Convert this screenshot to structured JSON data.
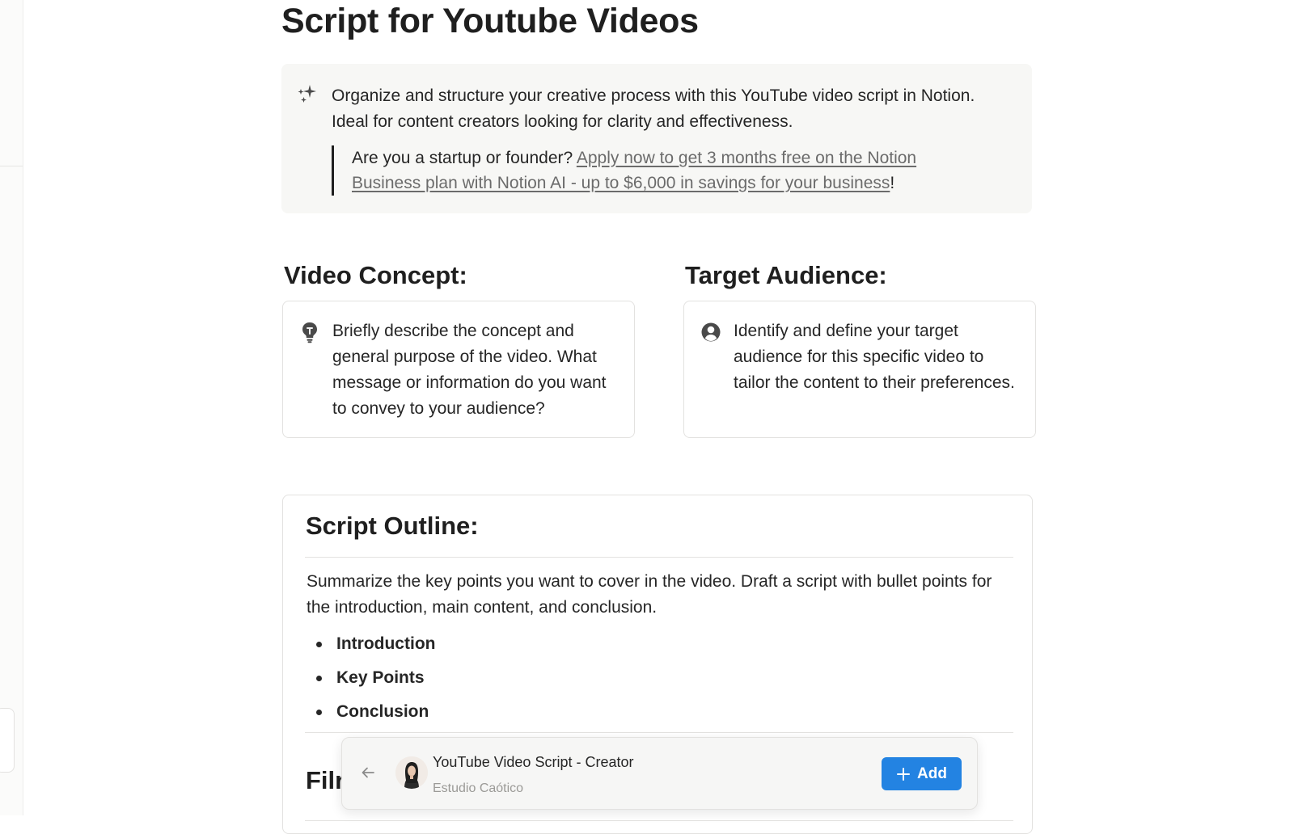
{
  "page": {
    "title": "Script for Youtube Videos"
  },
  "callout": {
    "icon": "sparkles-icon",
    "intro": "Organize and structure your creative process with this YouTube video script in Notion. Ideal for content creators looking for clarity and effectiveness.",
    "quote_prefix": "Are you a startup or founder? ",
    "quote_link": "Apply now to get 3 months free on the Notion Business plan with Notion AI - up to $6,000 in savings for your business",
    "quote_suffix": "!"
  },
  "video_concept": {
    "heading": "Video Concept:",
    "icon": "lightbulb-icon",
    "text": "Briefly describe the concept and general purpose of the video. What message or information do you want to convey to your audience?"
  },
  "target_audience": {
    "heading": "Target Audience:",
    "icon": "user-circle-icon",
    "text": "Identify and define your target audience for this specific video to tailor the content to their preferences."
  },
  "script_outline": {
    "heading": "Script Outline:",
    "summary": "Summarize the key points you want to cover in the video. Draft a script with bullet points for the introduction, main content, and conclusion.",
    "items": [
      "Introduction",
      "Key Points",
      "Conclusion"
    ],
    "next_heading_partial": "Filr"
  },
  "template_bar": {
    "title": "YouTube Video Script - Creator",
    "author": "Estudio Caótico",
    "add_label": "Add",
    "accent": "#2383e2"
  }
}
